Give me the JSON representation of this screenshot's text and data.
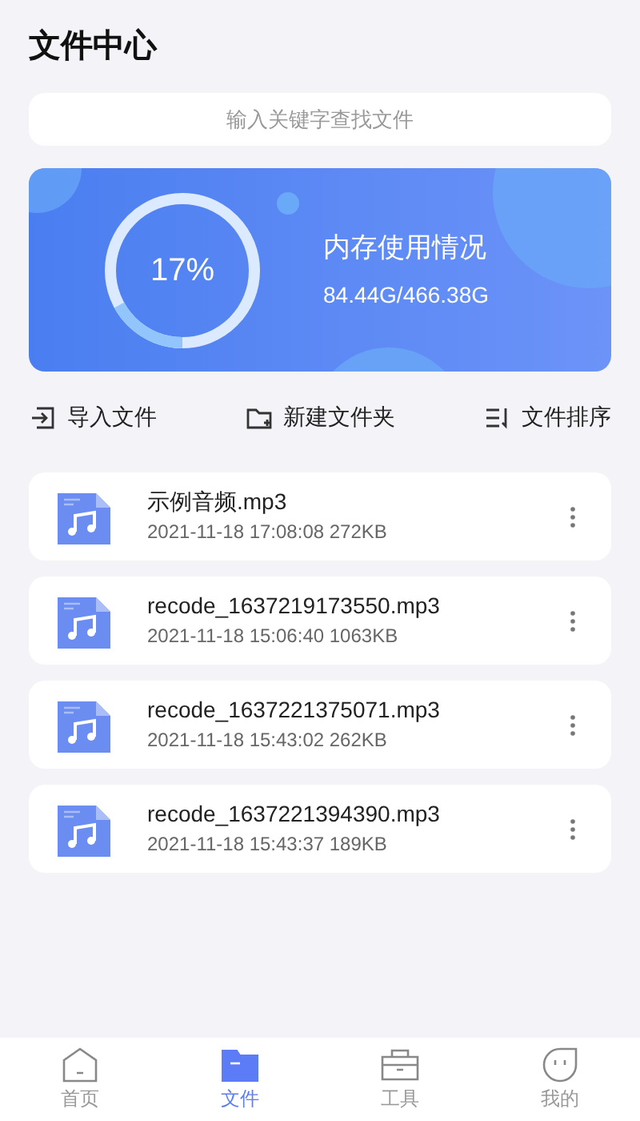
{
  "header": {
    "title": "文件中心"
  },
  "search": {
    "placeholder": "输入关键字查找文件"
  },
  "storage": {
    "percent": "17%",
    "level": 0.17,
    "title": "内存使用情况",
    "usage": "84.44G/466.38G"
  },
  "actions": [
    {
      "kind": "import",
      "label": "导入文件"
    },
    {
      "kind": "new-folder",
      "label": "新建文件夹"
    },
    {
      "kind": "sort",
      "label": "文件排序"
    }
  ],
  "files": [
    {
      "name": "示例音频.mp3",
      "meta": "2021-11-18 17:08:08 272KB"
    },
    {
      "name": "recode_1637219173550.mp3",
      "meta": "2021-11-18 15:06:40 1063KB"
    },
    {
      "name": "recode_1637221375071.mp3",
      "meta": "2021-11-18 15:43:02 262KB"
    },
    {
      "name": "recode_1637221394390.mp3",
      "meta": "2021-11-18 15:43:37 189KB"
    }
  ],
  "nav": [
    {
      "kind": "home",
      "label": "首页",
      "selected": false
    },
    {
      "kind": "files",
      "label": "文件",
      "selected": true
    },
    {
      "kind": "tools",
      "label": "工具",
      "selected": false
    },
    {
      "kind": "me",
      "label": "我的",
      "selected": false
    }
  ]
}
